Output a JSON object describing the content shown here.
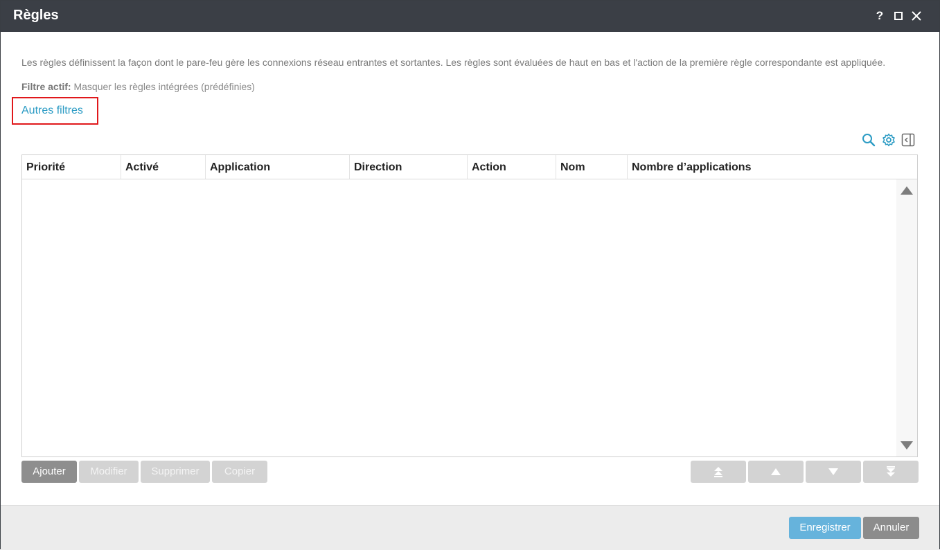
{
  "window": {
    "title": "Règles",
    "help_label": "?"
  },
  "description": "Les règles définissent la façon dont le pare-feu gère les connexions réseau entrantes et sortantes. Les règles sont évaluées de haut en bas et l'action de la première règle correspondante est appliquée.",
  "filter": {
    "label": "Filtre actif:",
    "value": "Masquer les règles intégrées (prédéfinies)",
    "other_filters_link": "Autres filtres"
  },
  "table": {
    "columns": [
      "Priorité",
      "Activé",
      "Application",
      "Direction",
      "Action",
      "Nom",
      "Nombre d’applications"
    ],
    "rows": []
  },
  "actions": {
    "add": "Ajouter",
    "edit": "Modifier",
    "delete": "Supprimer",
    "copy": "Copier"
  },
  "footer": {
    "save": "Enregistrer",
    "cancel": "Annuler"
  },
  "icons": {
    "search": "search-icon",
    "settings": "gear-icon",
    "panel": "collapse-panel-icon",
    "move_top": "move-to-top-icon",
    "move_up": "move-up-icon",
    "move_down": "move-down-icon",
    "move_bottom": "move-to-bottom-icon"
  },
  "colors": {
    "titlebar": "#3b3f46",
    "link": "#2b9bc4",
    "highlight_border": "#e0181b",
    "primary_button": "#66b3dc",
    "secondary_button": "#8c8c8c",
    "disabled_button": "#d3d3d3"
  }
}
